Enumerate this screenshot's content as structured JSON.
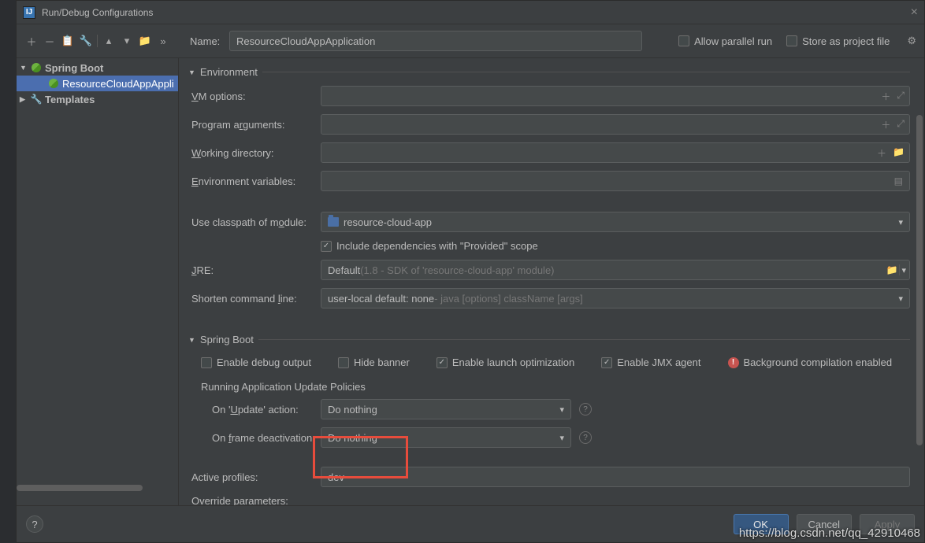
{
  "window": {
    "title": "Run/Debug Configurations"
  },
  "toolbar": {
    "name_label": "Name:",
    "name_value": "ResourceCloudAppApplication",
    "allow_parallel": "Allow parallel run",
    "store_as_template": "Store as project file"
  },
  "tree": {
    "spring_boot": "Spring Boot",
    "app_item": "ResourceCloudAppAppli",
    "templates": "Templates"
  },
  "sections": {
    "environment": "Environment",
    "spring_boot": "Spring Boot"
  },
  "env": {
    "vm_label": "VM options:",
    "prog_args_label": "Program arguments:",
    "workdir_label": "Working directory:",
    "env_vars_label": "Environment variables:",
    "classpath_label": "Use classpath of module:",
    "classpath_value": "resource-cloud-app",
    "include_provided": "Include dependencies with \"Provided\" scope",
    "jre_label": "JRE:",
    "jre_value": "Default ",
    "jre_detail": "(1.8 - SDK of 'resource-cloud-app' module)",
    "shorten_label": "Shorten command line:",
    "shorten_value": "user-local default: none ",
    "shorten_detail": "- java [options] className [args]"
  },
  "spring": {
    "enable_debug": "Enable debug output",
    "hide_banner": "Hide banner",
    "enable_launch_opt": "Enable launch optimization",
    "enable_jmx": "Enable JMX agent",
    "bg_compile": "Background compilation enabled",
    "update_policies": "Running Application Update Policies",
    "on_update_label": "On 'Update' action:",
    "on_update_value": "Do nothing",
    "on_deactivate_label": "On frame deactivation:",
    "on_deactivate_value": "Do nothing",
    "active_profiles_label": "Active profiles:",
    "active_profiles_value": "dev",
    "override_params_label": "Override parameters:"
  },
  "buttons": {
    "ok": "OK",
    "cancel": "Cancel",
    "apply": "Apply"
  },
  "watermark": "https://blog.csdn.net/qq_42910468"
}
